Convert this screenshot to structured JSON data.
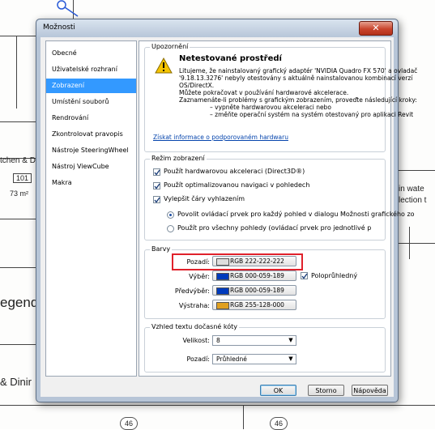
{
  "background": {
    "labels": [
      "tchen & Din",
      "101",
      "73 m²",
      "egend",
      "& Dinir",
      "in wate",
      "lection t"
    ],
    "tags": [
      "46",
      "46"
    ]
  },
  "dialog": {
    "title": "Možnosti",
    "close_label": "✕"
  },
  "sidebar": {
    "items": [
      {
        "label": "Obecné"
      },
      {
        "label": "Uživatelské rozhraní"
      },
      {
        "label": "Zobrazení"
      },
      {
        "label": "Umístění souborů"
      },
      {
        "label": "Rendrování"
      },
      {
        "label": "Zkontrolovat pravopis"
      },
      {
        "label": "Nástroje SteeringWheel"
      },
      {
        "label": "Nástroj ViewCube"
      },
      {
        "label": "Makra"
      }
    ],
    "selected": "Zobrazení"
  },
  "warning": {
    "group_label": "Upozornění",
    "heading": "Netestované prostředí",
    "lines": [
      "Litujeme, že nainstalovaný grafický adaptér 'NVIDIA Quadro FX 570' a ovladač",
      "'9.18.13.3276' nebyly otestovány s aktuálně nainstalovanou kombinací verzí",
      "OS/DirectX.",
      "Můžete pokračovat v používání hardwarové akcelerace.",
      "Zaznamenáte-li problémy s grafickým zobrazením, proveďte následující kroky:",
      "– vypněte hardwarovou akceleraci nebo",
      "– změňte operační systém na systém otestovaný pro aplikaci Revit"
    ],
    "link": "Získat informace o podporovaném hardwaru"
  },
  "display_mode": {
    "group_label": "Režim zobrazení",
    "checkboxes": [
      {
        "label": "Použít hardwarovou akceleraci (Direct3D®)",
        "checked": true
      },
      {
        "label": "Použít optimalizovanou navigaci v pohledech",
        "checked": true
      },
      {
        "label": "Vylepšit čáry vyhlazením",
        "checked": true
      }
    ],
    "radios": [
      {
        "label": "Povolit ovládací prvek pro každý pohled v dialogu Možnosti grafického zo",
        "selected": true
      },
      {
        "label": "Použít pro všechny pohledy (ovládací prvek pro jednotlivé p",
        "selected": false
      }
    ]
  },
  "colors": {
    "group_label": "Barvy",
    "rows": [
      {
        "label": "Pozadí:",
        "value": "RGB 222-222-222",
        "swatch": "#dedede"
      },
      {
        "label": "Výběr:",
        "value": "RGB 000-059-189",
        "swatch": "#003bbd"
      },
      {
        "label": "Předvýběr:",
        "value": "RGB 000-059-189",
        "swatch": "#003bbd"
      },
      {
        "label": "Výstraha:",
        "value": "RGB 255-128-000",
        "swatch": "#ff8000"
      }
    ],
    "semi_transparent": {
      "label": "Poloprůhledný",
      "checked": true
    },
    "highlight_color": "#e0212b"
  },
  "temp_dimensions": {
    "group_label": "Vzhled textu dočasné kóty",
    "size_label": "Velikost:",
    "size_value": "8",
    "background_label": "Pozadí:",
    "background_value": "Průhledné"
  },
  "buttons": {
    "ok": "OK",
    "cancel": "Storno",
    "help": "Nápověda"
  }
}
